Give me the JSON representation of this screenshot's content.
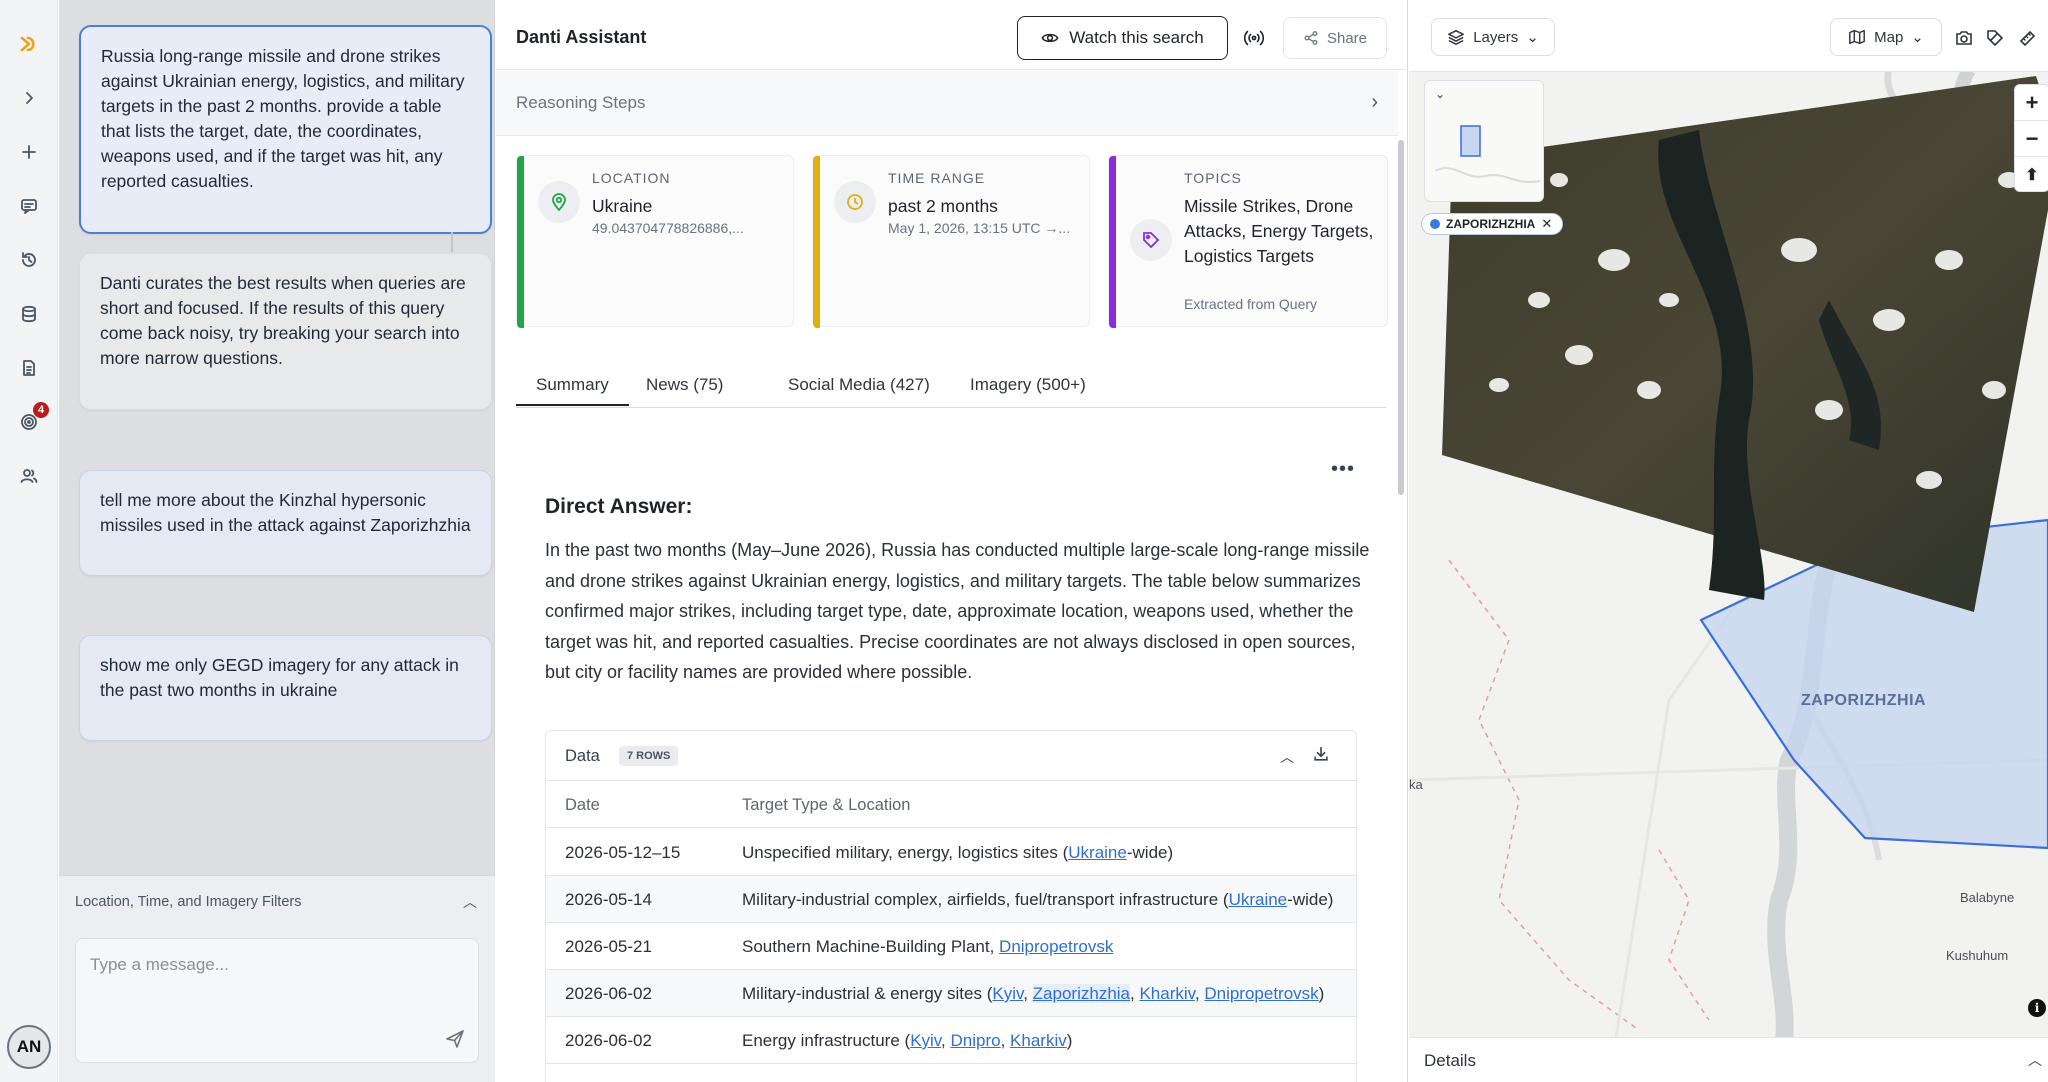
{
  "sidebar": {
    "notification_count": "4",
    "avatar_initials": "AN"
  },
  "chat": {
    "messages": [
      {
        "text": "Russia long-range missile and drone strikes against Ukrainian energy, logistics, and military targets in the past 2 months. provide a table that lists the target, date, the coordinates, weapons used, and if the target was hit, any reported casualties."
      },
      {
        "text": "Danti curates the best results when queries are short and focused. If the results of this query come back noisy, try breaking your search into more narrow questions."
      },
      {
        "text": "tell me more about the Kinzhal hypersonic missiles used in the attack against Zaporizhzhia"
      },
      {
        "text": "show me only GEGD imagery for any attack in the past two months in ukraine"
      }
    ],
    "filters_label": "Location, Time, and Imagery Filters",
    "input_placeholder": "Type a message..."
  },
  "main": {
    "title": "Danti Assistant",
    "watch_label": "Watch this search",
    "share_label": "Share",
    "reasoning_label": "Reasoning Steps",
    "cards": [
      {
        "label": "LOCATION",
        "value": "Ukraine",
        "sub": "49.043704778826886,...",
        "color": "#22a447"
      },
      {
        "label": "TIME RANGE",
        "value": "past 2 months",
        "sub": "May 1, 2026, 13:15 UTC →...",
        "color": "#e0b010"
      },
      {
        "label": "TOPICS",
        "value": "Missile Strikes, Drone Attacks, Energy Targets, Logistics Targets",
        "sub": "Extracted from Query",
        "color": "#8a2be2"
      }
    ],
    "tabs": [
      "Summary",
      "News (75)",
      "Social Media (427)",
      "Imagery (500+)"
    ],
    "direct_answer_title": "Direct Answer:",
    "direct_answer_text": "In the past two months (May–June 2026), Russia has conducted multiple large-scale long-range missile and drone strikes against Ukrainian energy, logistics, and military targets. The table below summarizes confirmed major strikes, including target type, date, approximate location, weapons used, whether the target was hit, and reported casualties. Precise coordinates are not always disclosed in open sources, but city or facility names are provided where possible.",
    "table": {
      "label": "Data",
      "rows_badge": "7 ROWS",
      "columns": [
        "Date",
        "Target Type & Location"
      ],
      "rows": [
        {
          "date": "2026-05-12–15",
          "pre": "Unspecified military, energy, logistics sites (",
          "links": [
            "Ukraine"
          ],
          "post": "-wide)"
        },
        {
          "date": "2026-05-14",
          "pre": "Military-industrial complex, airfields, fuel/transport infrastructure (",
          "links": [
            "Ukraine"
          ],
          "post": "-wide)"
        },
        {
          "date": "2026-05-21",
          "pre": "Southern Machine-Building Plant, ",
          "links": [
            "Dnipropetrovsk"
          ],
          "post": ""
        },
        {
          "date": "2026-06-02",
          "pre": "Military-industrial & energy sites (",
          "links": [
            "Kyiv",
            "Zaporizhzhia",
            "Kharkiv",
            "Dnipropetrovsk"
          ],
          "post": ")"
        },
        {
          "date": "2026-06-02",
          "pre": "Energy infrastructure (",
          "links": [
            "Kyiv",
            "Dnipro",
            "Kharkiv"
          ],
          "post": ")"
        }
      ]
    }
  },
  "map": {
    "layers_label": "Layers",
    "basemap_label": "Map",
    "chip_label": "ZAPORIZHZHIA",
    "region_label": "ZAPORIZHZHIA",
    "places": [
      "Balabyne",
      "Kushuhum",
      "ka"
    ],
    "details_label": "Details"
  }
}
